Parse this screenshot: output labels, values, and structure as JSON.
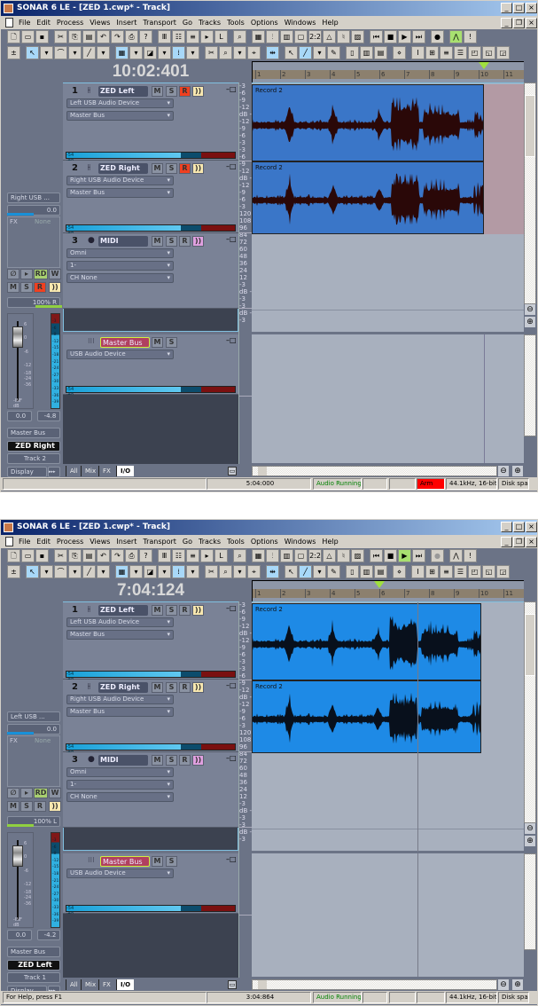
{
  "menu": [
    "File",
    "Edit",
    "Process",
    "Views",
    "Insert",
    "Transport",
    "Go",
    "Tracks",
    "Tools",
    "Options",
    "Windows",
    "Help"
  ],
  "toolbar1": [
    "🗋",
    "▭",
    "▪",
    "|",
    "✂",
    "⎘",
    "▤",
    "↶",
    "↷",
    "⎙",
    "?",
    "|",
    "Ⅲ",
    "☷",
    "≡",
    "▸",
    "L",
    "|",
    "⌕",
    "|",
    "▦",
    "⫶",
    "▥",
    "▢",
    "2:2",
    "△",
    "♮",
    "▨",
    "|",
    "⏮",
    "■",
    "▶",
    "⏭",
    "|",
    "●",
    "|",
    "⋀",
    "!"
  ],
  "toolbar2": [
    "±",
    "|",
    "↖",
    "▾",
    "⌒",
    "▾",
    "╱",
    "▾",
    "|",
    "▦",
    "▾",
    "◪",
    "▾",
    "⁞",
    "▾",
    "|",
    "✂",
    "⌕",
    "▾",
    "⌖",
    "|",
    "⇹",
    "|",
    "↖",
    "╱",
    "▾",
    "✎",
    "|",
    "▯",
    "▥",
    "▤",
    "|",
    "⋄",
    "|",
    "Ⅰ",
    "⊞",
    "≡",
    "☰",
    "◰",
    "◱",
    "◲"
  ],
  "colors": {
    "record_armed": "#f04020",
    "rd_on": "#a8d070",
    "echo": "#f8e8b0",
    "midi_echo": "#e0a0e0",
    "bus_name": "#b04060",
    "status_green": "#008000",
    "arm_red": "#ff0000"
  },
  "meter_labels": [
    "-54",
    "-48",
    "-42",
    "-36",
    "-30",
    "-24",
    "-18",
    "-12",
    "-6"
  ],
  "audio_scale": [
    "-3",
    "-6",
    "-9",
    "-12",
    "dB -",
    "-12",
    "-9",
    "-6",
    "-3"
  ],
  "midi_scale": [
    "120",
    "108",
    "96",
    "84",
    "72",
    "60",
    "48",
    "36",
    "24",
    "12"
  ],
  "bus_scale": [
    "-3",
    "dB -",
    "-3",
    "-3",
    "dB -",
    "-3"
  ],
  "fader_scale": [
    "6",
    "0",
    "-6",
    "-12",
    "-18",
    "-24",
    "-36",
    "-INF",
    "dB"
  ],
  "inspector_meter_scale": [
    "-3",
    "-6",
    "-9",
    "-12",
    "-15",
    "-18",
    "-21",
    "-24",
    "-27",
    "-30",
    "-33",
    "-36",
    "-39"
  ],
  "ruler_measures": [
    "1",
    "2",
    "3",
    "4",
    "5",
    "6",
    "7",
    "8",
    "9",
    "10",
    "11"
  ],
  "windows": [
    {
      "title": "SONAR 6 LE - [ZED 1.cwp* - Track]",
      "time": "10:02:401",
      "playhead_measure": 10.2,
      "clip_color": "#3a76c8",
      "wave_color": "#2a0808",
      "tracks": [
        {
          "num": "1",
          "name": "ZED Left",
          "input": "Left USB Audio Device",
          "output": "Master Bus",
          "armed": true
        },
        {
          "num": "2",
          "name": "ZED Right",
          "input": "Right USB Audio Device",
          "output": "Master Bus",
          "armed": true
        },
        {
          "num": "3",
          "name": "MIDI",
          "input": "Omni",
          "output": "1-",
          "channel": "CH None",
          "armed": false
        }
      ],
      "bus": {
        "name": "Master Bus",
        "output": "USB Audio Device"
      },
      "clip_name": "Record 2",
      "inspector": {
        "input": "Right USB ...",
        "gain": "0.0",
        "fx_label": "FX",
        "fx_value": "None",
        "pan": "100% R",
        "volume": "0.0",
        "peak": "-4.8",
        "output": "Master Bus",
        "track_name": "ZED Right",
        "track_label": "Track 2",
        "display": "Display",
        "armed": true
      },
      "buttons": {
        "mute": "M",
        "solo": "S",
        "rec": "R",
        "echo": "))",
        "rd": "RD",
        "w": "W",
        "phase": "∅",
        "play": "▸"
      },
      "tabs": [
        "All",
        "Mix",
        "FX",
        "I/O"
      ],
      "status": {
        "help": "",
        "now": "5:04:000",
        "audio": "Audio Running",
        "b1": "",
        "b2": "",
        "arm": "Arm",
        "format": "44.1kHz, 16-bit",
        "disk": "Disk spac"
      }
    },
    {
      "title": "SONAR 6 LE - [ZED 1.cwp* - Track]",
      "time": "7:04:124",
      "playhead_measure": 6,
      "clip_color": "#1e8ae6",
      "wave_color": "#08101c",
      "tracks": [
        {
          "num": "1",
          "name": "ZED Left",
          "input": "Left USB Audio Device",
          "output": "Master Bus",
          "armed": false
        },
        {
          "num": "2",
          "name": "ZED Right",
          "input": "Right USB Audio Device",
          "output": "Master Bus",
          "armed": false
        },
        {
          "num": "3",
          "name": "MIDI",
          "input": "Omni",
          "output": "1-",
          "channel": "CH None",
          "armed": false
        }
      ],
      "bus": {
        "name": "Master Bus",
        "output": "USB Audio Device"
      },
      "clip_name": "Record 2",
      "inspector": {
        "input": "Left USB ...",
        "gain": "0.0",
        "fx_label": "FX",
        "fx_value": "None",
        "pan": "100% L",
        "volume": "0.0",
        "peak": "-4.2",
        "output": "Master Bus",
        "track_name": "ZED Left",
        "track_label": "Track 1",
        "display": "Display",
        "armed": false
      },
      "buttons": {
        "mute": "M",
        "solo": "S",
        "rec": "R",
        "echo": "))",
        "rd": "RD",
        "w": "W",
        "phase": "∅",
        "play": "▸"
      },
      "tabs": [
        "All",
        "Mix",
        "FX",
        "I/O"
      ],
      "status": {
        "help": "For Help, press F1",
        "now": "3:04:864",
        "audio": "Audio Running",
        "b1": "",
        "b2": "",
        "arm": "",
        "format": "44.1kHz, 16-bit",
        "disk": "Disk spac"
      }
    }
  ]
}
